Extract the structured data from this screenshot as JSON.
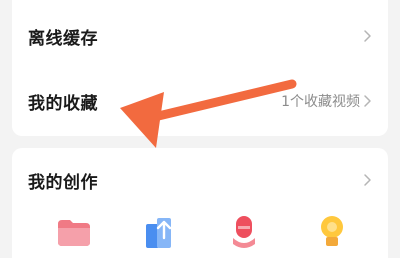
{
  "menu": {
    "offline_cache": {
      "label": "离线缓存"
    },
    "my_favorites": {
      "label": "我的收藏",
      "value": "1个收藏视频"
    }
  },
  "creation": {
    "title": "我的创作",
    "tools": [
      {
        "icon": "folder-icon"
      },
      {
        "icon": "upload-icon"
      },
      {
        "icon": "microphone-icon"
      },
      {
        "icon": "lightbulb-icon"
      }
    ]
  },
  "annotation": {
    "icon": "arrow-pointer-icon",
    "color": "#f26a3f"
  },
  "colors": {
    "background": "#f3f3f3",
    "card": "#ffffff",
    "accent": "#f26a3f"
  }
}
